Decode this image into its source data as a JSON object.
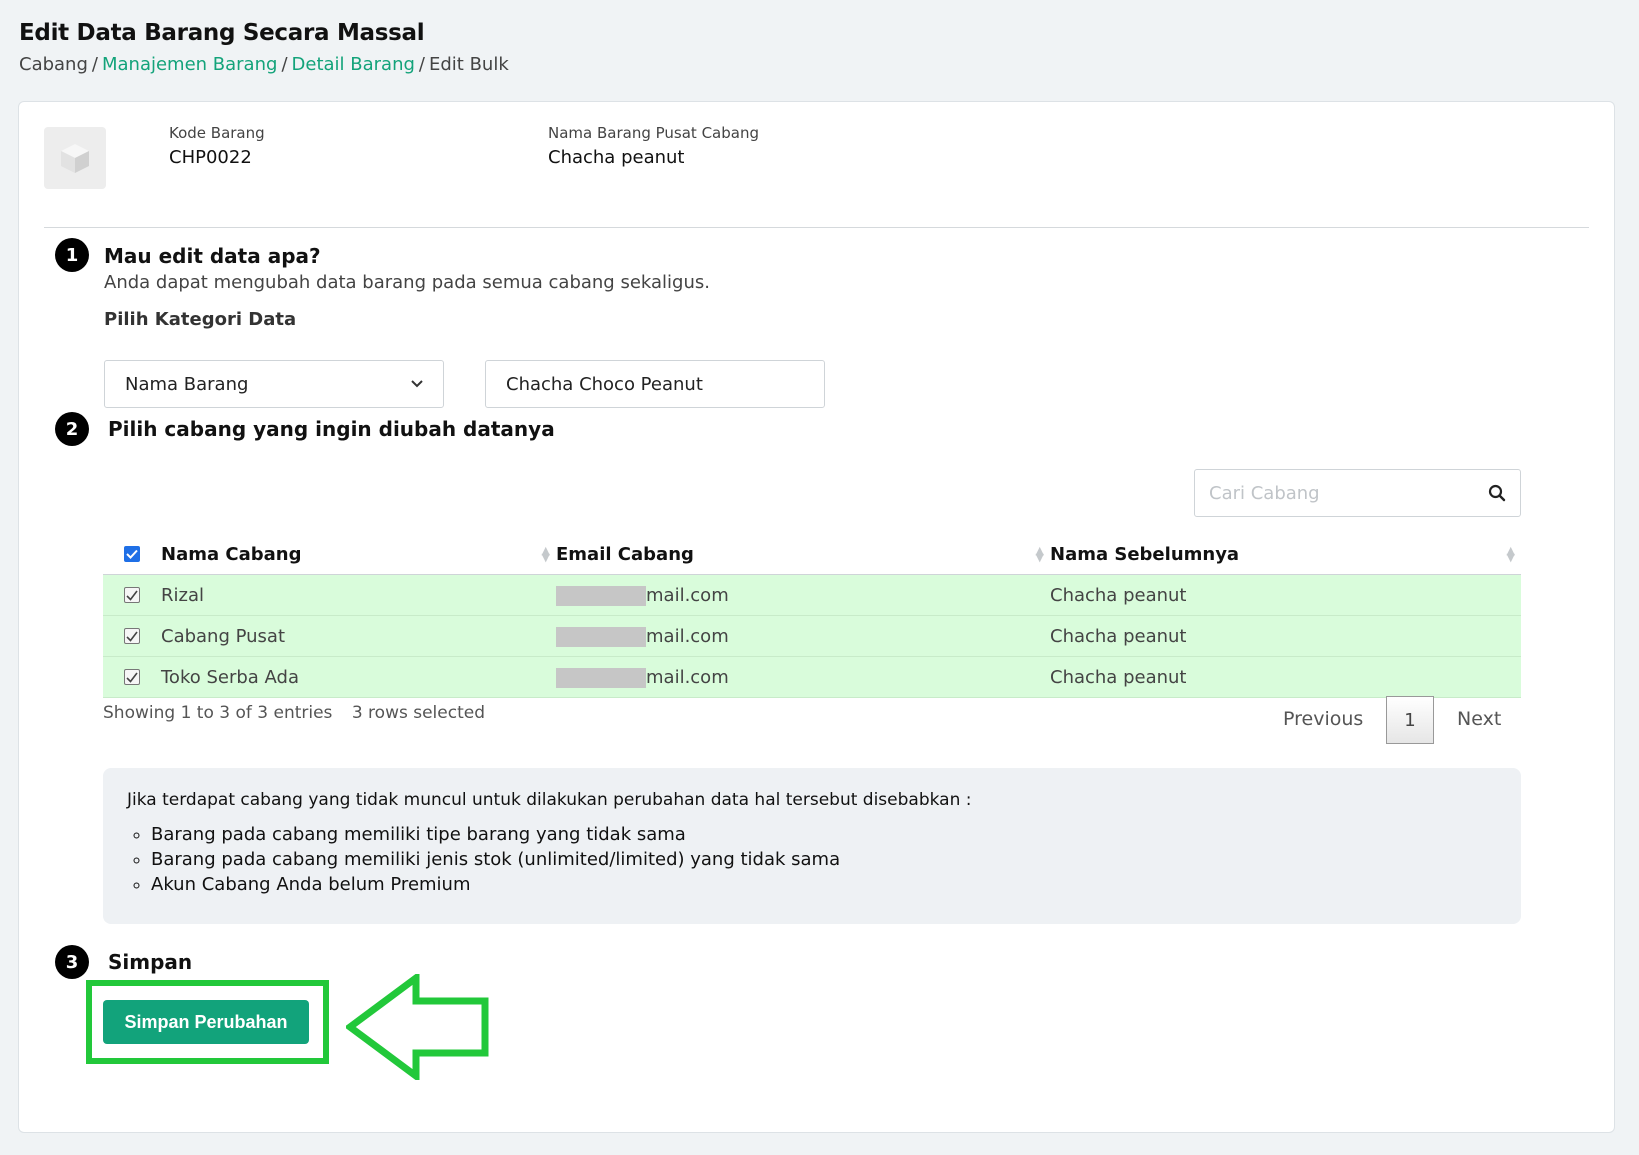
{
  "header": {
    "title": "Edit Data Barang Secara Massal",
    "breadcrumb": {
      "item1": "Cabang",
      "item2": "Manajemen Barang",
      "item3": "Detail Barang",
      "item4": "Edit Bulk",
      "separator": "/"
    }
  },
  "product": {
    "code_label": "Kode Barang",
    "code_value": "CHP0022",
    "name_label": "Nama Barang Pusat Cabang",
    "name_value": "Chacha peanut"
  },
  "step1": {
    "number": "1",
    "title": "Mau edit data apa?",
    "description": "Anda dapat mengubah data barang pada semua cabang sekaligus.",
    "category_label": "Pilih Kategori Data",
    "category_selected": "Nama Barang",
    "value_input": "Chacha Choco Peanut"
  },
  "step2": {
    "number": "2",
    "title": "Pilih cabang yang ingin diubah datanya",
    "search_placeholder": "Cari Cabang",
    "columns": {
      "name": "Nama Cabang",
      "email": "Email Cabang",
      "previous": "Nama Sebelumnya"
    },
    "rows": [
      {
        "name": "Rizal",
        "email_suffix": "mail.com",
        "previous": "Chacha peanut"
      },
      {
        "name": "Cabang Pusat",
        "email_suffix": "mail.com",
        "previous": "Chacha peanut"
      },
      {
        "name": "Toko Serba Ada",
        "email_suffix": "mail.com",
        "previous": "Chacha peanut"
      }
    ],
    "info": "Showing 1 to 3 of 3 entries",
    "selected": "3 rows selected",
    "pagination": {
      "previous": "Previous",
      "page": "1",
      "next": "Next"
    }
  },
  "note": {
    "intro": "Jika terdapat cabang yang tidak muncul untuk dilakukan perubahan data hal tersebut disebabkan :",
    "items": [
      "Barang pada cabang memiliki tipe barang yang tidak sama",
      "Barang pada cabang memiliki jenis stok (unlimited/limited) yang tidak sama",
      "Akun Cabang Anda belum Premium"
    ]
  },
  "step3": {
    "number": "3",
    "title": "Simpan",
    "save_label": "Simpan Perubahan"
  },
  "colors": {
    "accent": "#12a37b",
    "row_selected": "#d9fcdb",
    "highlight": "#22c83a"
  }
}
